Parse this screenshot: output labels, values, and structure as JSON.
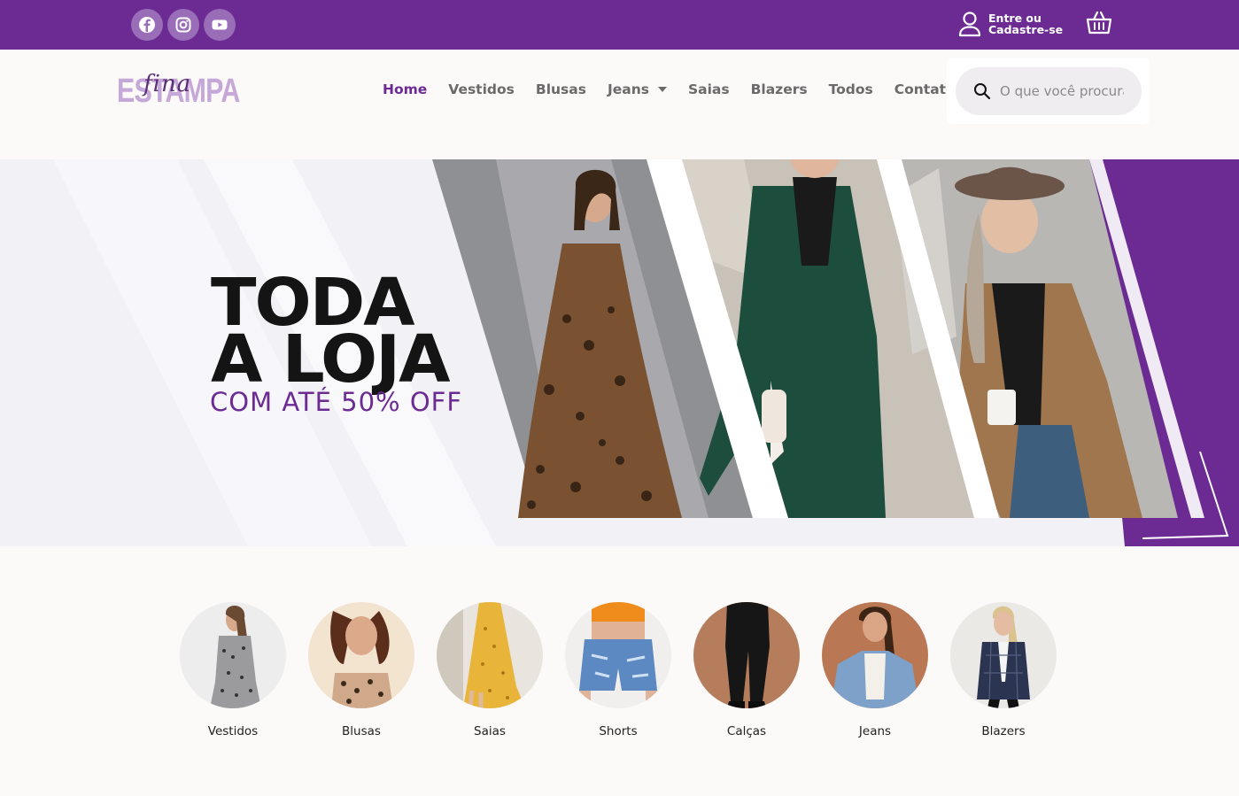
{
  "topbar": {
    "social": [
      {
        "icon": "facebook-icon"
      },
      {
        "icon": "instagram-icon"
      },
      {
        "icon": "youtube-icon"
      }
    ],
    "account_line1": "Entre ou",
    "account_line2": "Cadastre-se",
    "cart_icon": "basket-icon",
    "bg_color": "#6b2b93"
  },
  "header": {
    "logo_main": "ESTAMPA",
    "logo_script": "fina",
    "nav": [
      {
        "label": "Home",
        "active": true
      },
      {
        "label": "Vestidos"
      },
      {
        "label": "Blusas"
      },
      {
        "label": "Jeans",
        "dropdown": true
      },
      {
        "label": "Saias"
      },
      {
        "label": "Blazers"
      },
      {
        "label": "Todos"
      },
      {
        "label": "Contato"
      }
    ],
    "search_placeholder": "O que você procura?"
  },
  "hero": {
    "line1": "TODA",
    "line2": "A LOJA",
    "subtitle": "COM ATÉ 50% OFF",
    "accent_color": "#6b2b93"
  },
  "categories": [
    {
      "label": "Vestidos"
    },
    {
      "label": "Blusas"
    },
    {
      "label": "Saias"
    },
    {
      "label": "Shorts"
    },
    {
      "label": "Calças"
    },
    {
      "label": "Jeans"
    },
    {
      "label": "Blazers"
    }
  ]
}
